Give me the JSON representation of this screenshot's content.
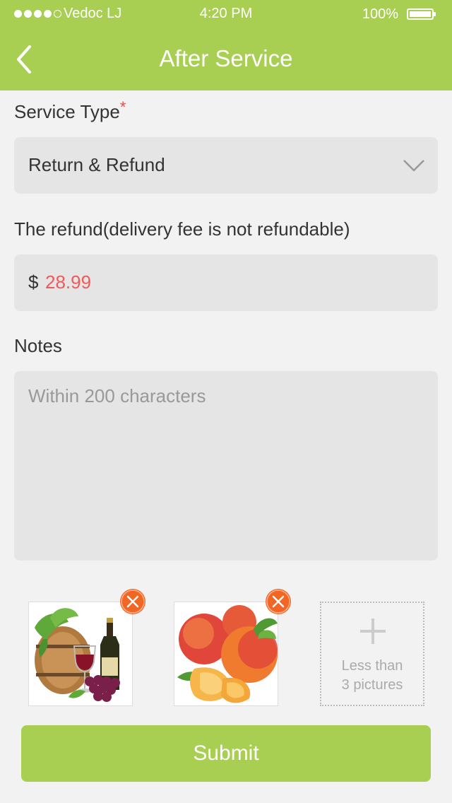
{
  "status_bar": {
    "carrier": "Vedoc LJ",
    "time": "4:20 PM",
    "battery": "100%"
  },
  "header": {
    "title": "After Service",
    "back_icon": "chevron-left-icon"
  },
  "service_type": {
    "label": "Service Type",
    "required_mark": "*",
    "selected_value": "Return & Refund",
    "dropdown_icon": "chevron-down-icon"
  },
  "refund": {
    "label": "The refund(delivery fee is not refundable)",
    "currency": "$",
    "amount": "28.99"
  },
  "notes": {
    "label": "Notes",
    "placeholder": "Within 200 characters"
  },
  "pictures": {
    "items": [
      {
        "subject": "wine-and-grapes-photo",
        "remove_icon": "close-icon"
      },
      {
        "subject": "peaches-photo",
        "remove_icon": "close-icon"
      }
    ],
    "add_icon": "plus-icon",
    "add_hint_line1": "Less than",
    "add_hint_line2": "3 pictures"
  },
  "submit_label": "Submit",
  "colors": {
    "brand_green": "#a8cf52",
    "amount_red": "#ef5a5a",
    "remove_orange": "#f26522",
    "field_bg": "#e5e5e5",
    "page_bg": "#f2f2f2"
  }
}
